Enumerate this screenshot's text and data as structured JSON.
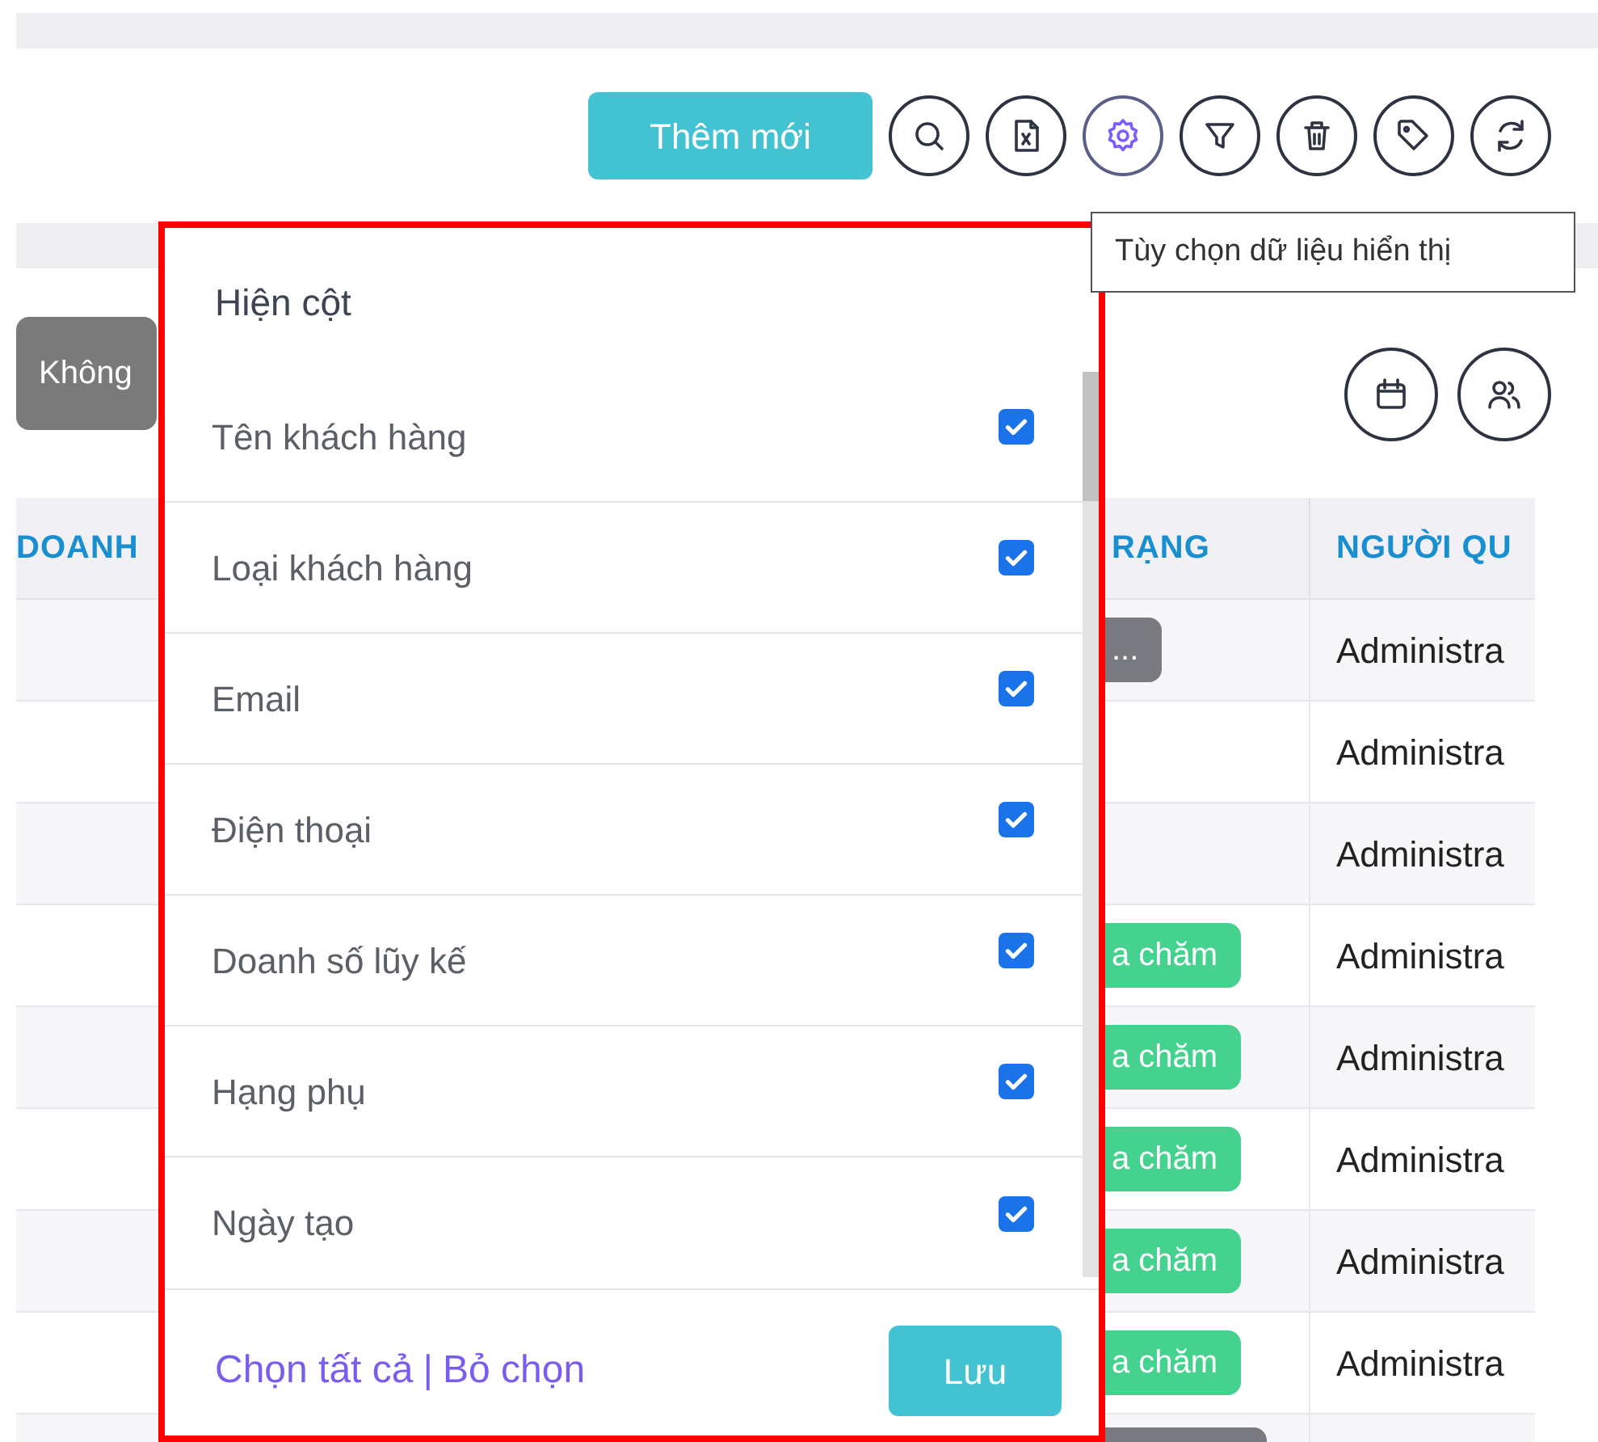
{
  "toolbar": {
    "add_button": "Thêm mới",
    "icon_buttons": [
      {
        "kind": "search",
        "selected": false
      },
      {
        "kind": "excel",
        "selected": false
      },
      {
        "kind": "settings",
        "selected": true
      },
      {
        "kind": "filter",
        "selected": false
      },
      {
        "kind": "delete",
        "selected": false
      },
      {
        "kind": "tag",
        "selected": false
      },
      {
        "kind": "refresh",
        "selected": false
      }
    ]
  },
  "tooltip": "Tùy chọn dữ liệu hiển thị",
  "filter_chip": "Không",
  "view_buttons": [
    {
      "kind": "calendar"
    },
    {
      "kind": "users"
    }
  ],
  "table": {
    "columns": [
      "DOANH",
      "RẠNG",
      "NGƯỜI QU"
    ],
    "rows": [
      {
        "status": {
          "text": "...",
          "color": "#7a7b80"
        },
        "manager": "Administra"
      },
      {
        "manager": "Administra"
      },
      {
        "manager": "Administra"
      },
      {
        "status": {
          "text": "a chăm",
          "color": "#45d18e"
        },
        "manager": "Administra"
      },
      {
        "status": {
          "text": "a chăm",
          "color": "#45d18e"
        },
        "manager": "Administra"
      },
      {
        "status": {
          "text": "a chăm",
          "color": "#45d18e"
        },
        "manager": "Administra"
      },
      {
        "status": {
          "text": "a chăm",
          "color": "#45d18e"
        },
        "manager": "Administra"
      },
      {
        "status": {
          "text": "a chăm",
          "color": "#45d18e"
        },
        "manager": "Administra"
      },
      {
        "status": {
          "color": "#7a7b80"
        }
      }
    ]
  },
  "column_picker": {
    "title": "Hiện cột",
    "items": [
      {
        "label": "Tên khách hàng",
        "checked": true
      },
      {
        "label": "Loại khách hàng",
        "checked": true
      },
      {
        "label": "Email",
        "checked": true
      },
      {
        "label": "Điện thoại",
        "checked": true
      },
      {
        "label": "Doanh số lũy kế",
        "checked": true
      },
      {
        "label": "Hạng phụ",
        "checked": true
      },
      {
        "label": "Ngày tạo",
        "checked": true
      }
    ],
    "select_all": "Chọn tất cả",
    "separator": "|",
    "deselect": "Bỏ chọn",
    "save": "Lưu"
  }
}
